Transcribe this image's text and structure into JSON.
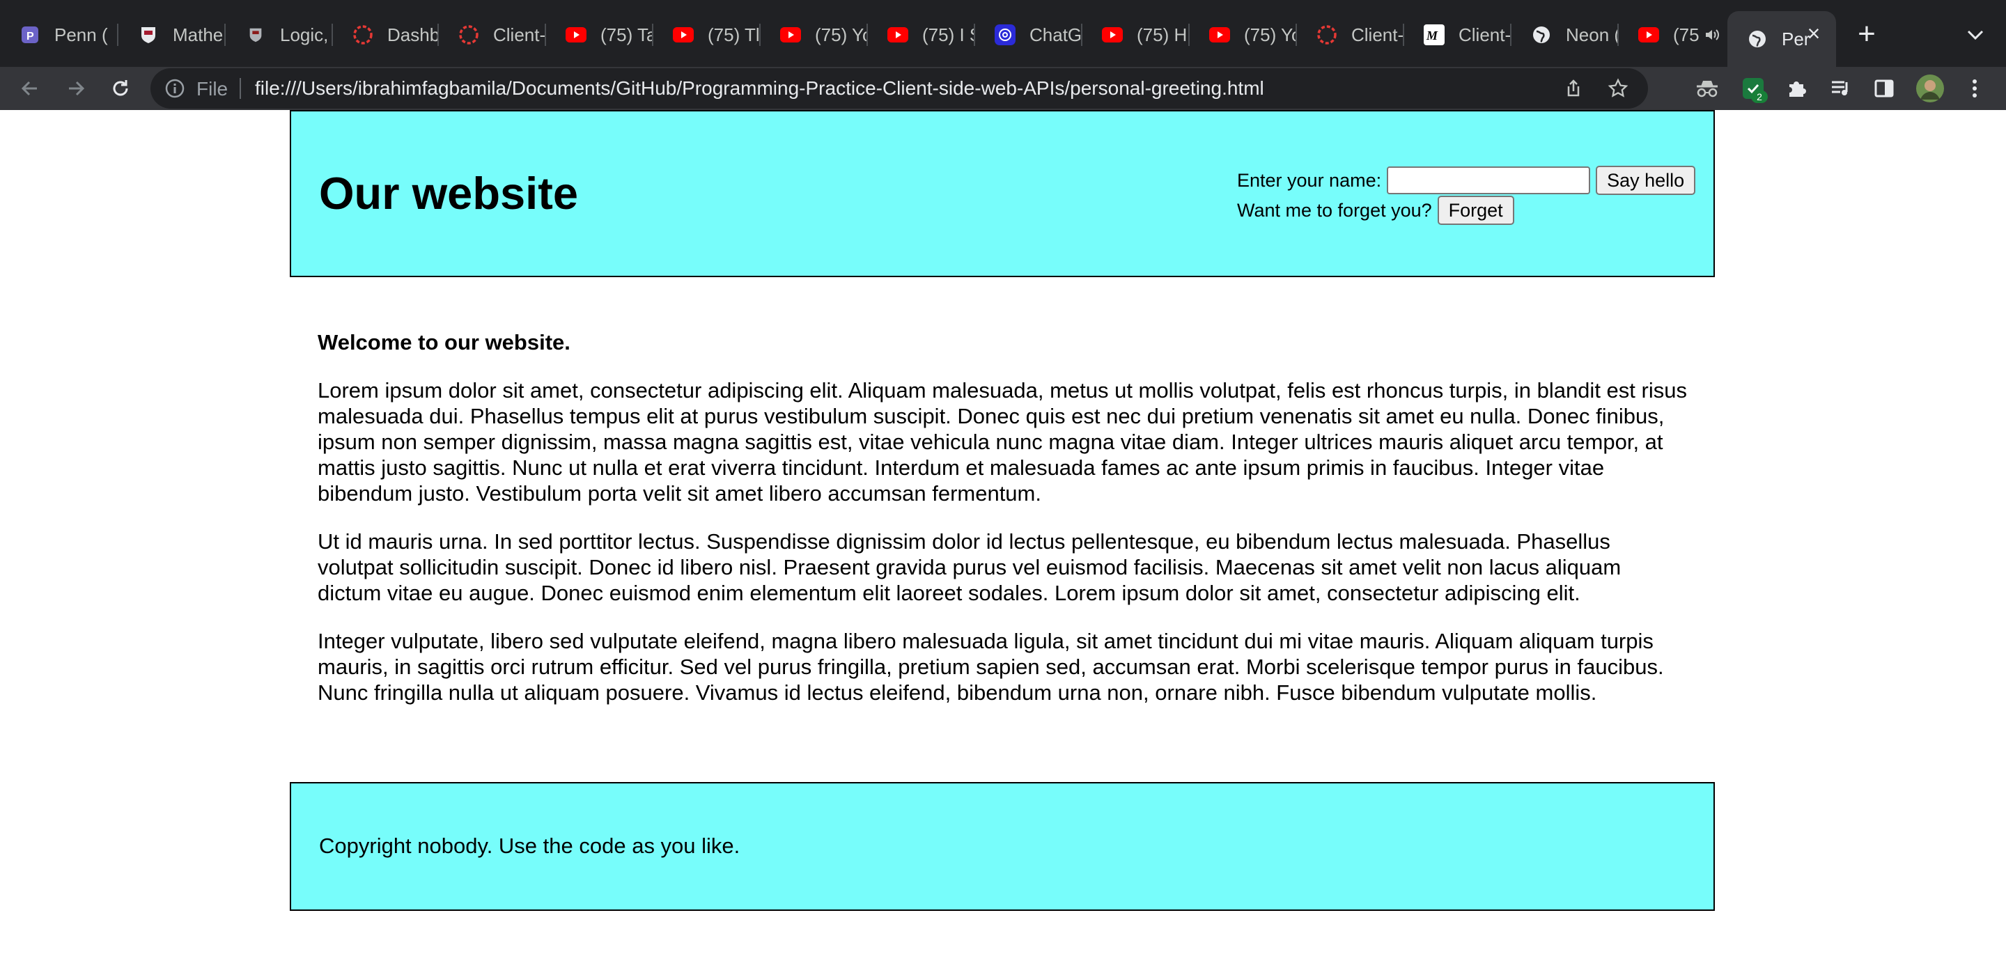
{
  "browser": {
    "tabs": [
      {
        "title": "Penn (",
        "icon": "penn-icon"
      },
      {
        "title": "Mathe",
        "icon": "university-crest-icon"
      },
      {
        "title": "Logic,",
        "icon": "crest-icon"
      },
      {
        "title": "Dashb",
        "icon": "dashed-circle-icon"
      },
      {
        "title": "Client-",
        "icon": "dashed-circle-icon"
      },
      {
        "title": "(75) Ta",
        "icon": "youtube-icon"
      },
      {
        "title": "(75) Tl",
        "icon": "youtube-icon"
      },
      {
        "title": "(75) Yo",
        "icon": "youtube-icon"
      },
      {
        "title": "(75) I S",
        "icon": "youtube-icon"
      },
      {
        "title": "ChatG",
        "icon": "chatgpt-icon"
      },
      {
        "title": "(75) H",
        "icon": "youtube-icon"
      },
      {
        "title": "(75) Yo",
        "icon": "youtube-icon"
      },
      {
        "title": "Client-",
        "icon": "dashed-circle-icon"
      },
      {
        "title": "Client-",
        "icon": "m-logo-icon"
      },
      {
        "title": "Neon (",
        "icon": "globe-icon"
      },
      {
        "title": "(75",
        "icon": "youtube-icon"
      }
    ],
    "active_tab": {
      "title": "Per",
      "icon": "globe-icon"
    },
    "address_prefix": "File",
    "url": "file:///Users/ibrahimfagbamila/Documents/GitHub/Programming-Practice-Client-side-web-APIs/personal-greeting.html",
    "extension_badge": "2",
    "colors": {
      "chrome_dark": "#202124",
      "toolbar": "#35363a",
      "youtube_red": "#ff0000"
    }
  },
  "page": {
    "title": "Our website",
    "name_label": "Enter your name:",
    "name_value": "",
    "say_hello_label": "Say hello",
    "forget_prompt": "Want me to forget you?",
    "forget_label": "Forget",
    "welcome": "Welcome to our website.",
    "paragraphs": [
      "Lorem ipsum dolor sit amet, consectetur adipiscing elit. Aliquam malesuada, metus ut mollis volutpat, felis est rhoncus turpis, in blandit est risus malesuada dui. Phasellus tempus elit at purus vestibulum suscipit. Donec quis est nec dui pretium venenatis sit amet eu nulla. Donec finibus, ipsum non semper dignissim, massa magna sagittis est, vitae vehicula nunc magna vitae diam. Integer ultrices mauris aliquet arcu tempor, at mattis justo sagittis. Nunc ut nulla et erat viverra tincidunt. Interdum et malesuada fames ac ante ipsum primis in faucibus. Integer vitae bibendum justo. Vestibulum porta velit sit amet libero accumsan fermentum.",
      "Ut id mauris urna. In sed porttitor lectus. Suspendisse dignissim dolor id lectus pellentesque, eu bibendum lectus malesuada. Phasellus volutpat sollicitudin suscipit. Donec id libero nisl. Praesent gravida purus vel euismod facilisis. Maecenas sit amet velit non lacus aliquam dictum vitae eu augue. Donec euismod enim elementum elit laoreet sodales. Lorem ipsum dolor sit amet, consectetur adipiscing elit.",
      "Integer vulputate, libero sed vulputate eleifend, magna libero malesuada ligula, sit amet tincidunt dui mi vitae mauris. Aliquam aliquam turpis mauris, in sagittis orci rutrum efficitur. Sed vel purus fringilla, pretium sapien sed, accumsan erat. Morbi scelerisque tempor purus in faucibus. Nunc fringilla nulla ut aliquam posuere. Vivamus id lectus eleifend, bibendum urna non, ornare nibh. Fusce bibendum vulputate mollis."
    ],
    "footer": "Copyright nobody. Use the code as you like.",
    "colors": {
      "band_background": "#77fdfb",
      "text": "#000000"
    }
  }
}
